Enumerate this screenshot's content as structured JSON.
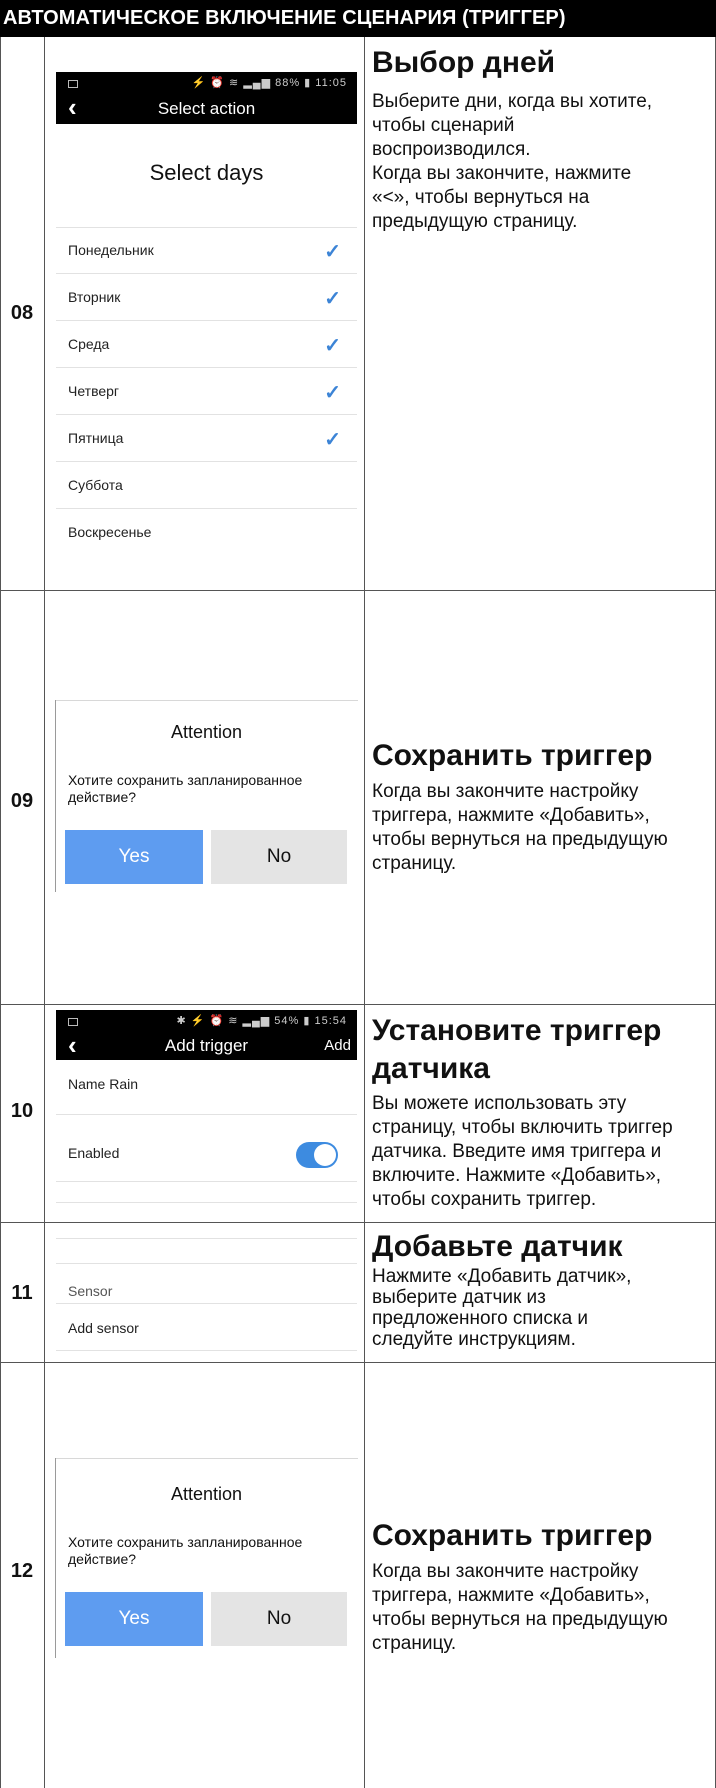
{
  "header": {
    "title": "АВТОМАТИЧЕСКОЕ ВКЛЮЧЕНИЕ СЦЕНАРИЯ (ТРИГГЕР)"
  },
  "steps": [
    {
      "number": "08",
      "title": "Выбор дней",
      "body": [
        "Выберите дни, когда вы хотите,",
        "чтобы сценарий",
        "воспроизводился.",
        " Когда вы закончите, нажмите",
        " «<», чтобы вернуться на",
        "предыдущую страницу."
      ],
      "phone": {
        "status_time": "88% ▮ 11:05",
        "action_title": "Select action",
        "heading": "Select days",
        "days": [
          {
            "label": "Понедельник",
            "checked": true
          },
          {
            "label": "Вторник",
            "checked": true
          },
          {
            "label": "Среда",
            "checked": true
          },
          {
            "label": "Четверг",
            "checked": true
          },
          {
            "label": "Пятница",
            "checked": true
          },
          {
            "label": "Суббота",
            "checked": false
          },
          {
            "label": "Воскресенье",
            "checked": false
          }
        ]
      }
    },
    {
      "number": "09",
      "title": "Сохранить триггер",
      "body": [
        "Когда вы закончите настройку",
        "триггера, нажмите «Добавить»,",
        "чтобы вернуться на предыдущую",
        "страницу."
      ],
      "dialog": {
        "title": "Attention",
        "message": [
          "Хотите сохранить запланированное",
          "действие?"
        ],
        "yes": "Yes",
        "no": "No"
      }
    },
    {
      "number": "10",
      "title": [
        "Установите триггер",
        "датчика"
      ],
      "body": [
        "Вы можете использовать эту",
        "страницу, чтобы включить триггер",
        "датчика. Введите имя триггера и",
        "включите. Нажмите «Добавить»,",
        "чтобы сохранить триггер."
      ],
      "phone": {
        "status_time": "54% ▮ 15:54",
        "action_title": "Add trigger",
        "action_right": "Add",
        "name_row": "Name Rain",
        "enabled_label": "Enabled",
        "enabled": true
      }
    },
    {
      "number": "11",
      "title": "Добавьте датчик",
      "body": [
        "Нажмите «Добавить датчик»,",
        "выберите датчик из",
        "предложенного списка и",
        "следуйте инструкциям."
      ],
      "screen": {
        "sensor_label": "Sensor",
        "add_sensor": "Add sensor"
      }
    },
    {
      "number": "12",
      "title": "Сохранить триггер",
      "body": [
        "Когда вы закончите настройку",
        "триггера, нажмите «Добавить»,",
        "чтобы вернуться на предыдущую",
        "страницу."
      ],
      "dialog": {
        "title": "Attention",
        "message": [
          "Хотите сохранить запланированное",
          "действие?"
        ],
        "yes": "Yes",
        "no": "No"
      }
    }
  ]
}
